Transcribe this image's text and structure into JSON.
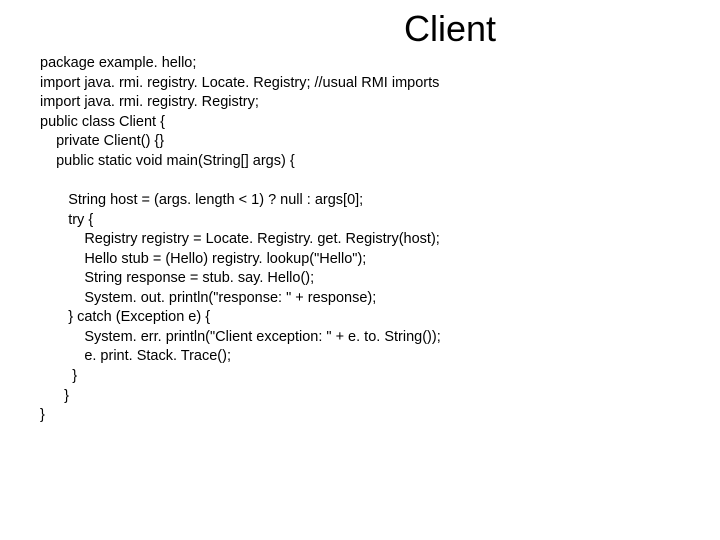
{
  "title": "Client",
  "code": {
    "l1": "package example. hello;",
    "l2": "import java. rmi. registry. Locate. Registry; //usual RMI imports",
    "l3": "import java. rmi. registry. Registry;",
    "l4": "public class Client {",
    "l5": "    private Client() {}",
    "l6": "    public static void main(String[] args) {",
    "l7": "",
    "l8": "       String host = (args. length < 1) ? null : args[0];",
    "l9": "       try {",
    "l10": "           Registry registry = Locate. Registry. get. Registry(host);",
    "l11": "           Hello stub = (Hello) registry. lookup(\"Hello\");",
    "l12": "           String response = stub. say. Hello();",
    "l13": "           System. out. println(\"response: \" + response);",
    "l14": "       } catch (Exception e) {",
    "l15": "           System. err. println(\"Client exception: \" + e. to. String());",
    "l16": "           e. print. Stack. Trace();",
    "l17": "        }",
    "l18": "      }",
    "l19": "}"
  }
}
